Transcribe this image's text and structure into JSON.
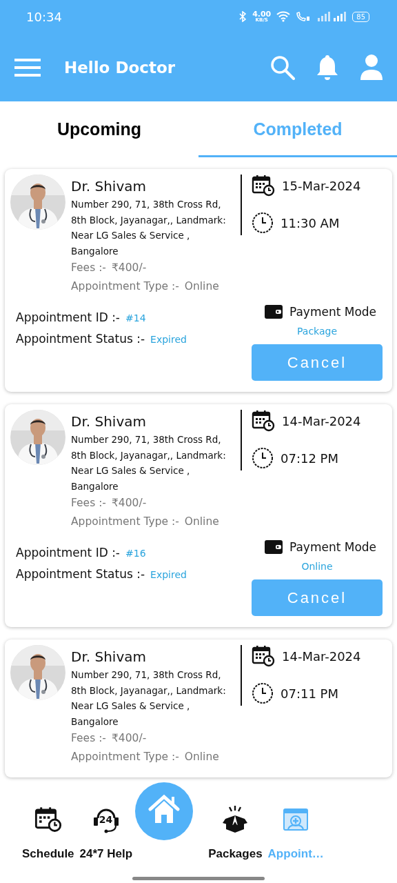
{
  "status_bar": {
    "time": "10:34",
    "net_speed": "4.00",
    "net_unit": "KB/S",
    "battery": "85"
  },
  "app_bar": {
    "title": "Hello Doctor"
  },
  "tabs": [
    {
      "label": "Upcoming",
      "selected": false
    },
    {
      "label": "Completed",
      "selected": true
    }
  ],
  "appointments": [
    {
      "doctor": "Dr. Shivam",
      "address": "Number 290, 71, 38th Cross Rd, 8th Block, Jayanagar,, Landmark: Near LG Sales & Service , Bangalore",
      "fees_label": "Fees :-",
      "fees": "₹400/-",
      "type_label": "Appointment Type :-",
      "type": "Online",
      "date": "15-Mar-2024",
      "time": "11:30 AM",
      "id_label": "Appointment ID :-",
      "id": "#14",
      "status_label": "Appointment Status :-",
      "status": "Expired",
      "payment_label": "Payment Mode",
      "payment": "Package",
      "button": "Cancel"
    },
    {
      "doctor": "Dr. Shivam",
      "address": "Number 290, 71, 38th Cross Rd, 8th Block, Jayanagar,, Landmark: Near LG Sales & Service , Bangalore",
      "fees_label": "Fees :-",
      "fees": "₹400/-",
      "type_label": "Appointment Type :-",
      "type": "Online",
      "date": "14-Mar-2024",
      "time": "07:12 PM",
      "id_label": "Appointment ID :-",
      "id": "#16",
      "status_label": "Appointment Status :-",
      "status": "Expired",
      "payment_label": "Payment Mode",
      "payment": "Online",
      "button": "Cancel"
    },
    {
      "doctor": "Dr. Shivam",
      "address": "Number 290, 71, 38th Cross Rd, 8th Block, Jayanagar,, Landmark: Near LG Sales & Service , Bangalore",
      "fees_label": "Fees :-",
      "fees": "₹400/-",
      "type_label": "Appointment Type :-",
      "type": "Online",
      "date": "14-Mar-2024",
      "time": "07:11 PM"
    }
  ],
  "bottom_nav": [
    {
      "kind": "schedule",
      "label": "Schedule",
      "selected": false
    },
    {
      "kind": "help",
      "label": "24*7 Help",
      "icon_text": "24",
      "selected": false
    },
    {
      "kind": "home",
      "selected": false
    },
    {
      "kind": "packages",
      "label": "Packages",
      "selected": false
    },
    {
      "kind": "appointments",
      "label": "Appoint…",
      "selected": true
    }
  ]
}
